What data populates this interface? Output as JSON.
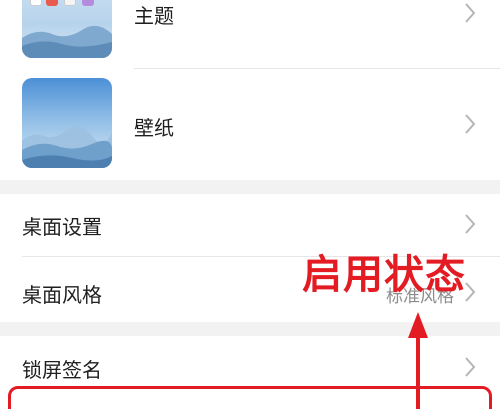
{
  "theme": {
    "label": "主题"
  },
  "wallpaper": {
    "label": "壁纸"
  },
  "desktop_settings": {
    "label": "桌面设置"
  },
  "desktop_style": {
    "label": "桌面风格",
    "value": "标准风格"
  },
  "lock_signature": {
    "label": "锁屏签名"
  },
  "annotation": {
    "text": "启用状态",
    "color": "#e31b23"
  }
}
